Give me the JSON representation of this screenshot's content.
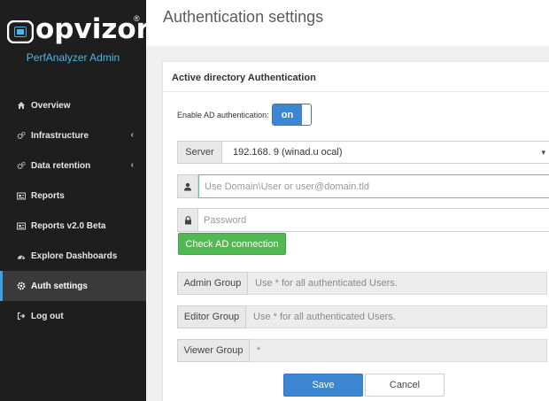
{
  "brand": {
    "logo_text": "opvizor",
    "logo_mark": "®",
    "subtitle": "PerfAnalyzer Admin",
    "accent": "#48b7f0"
  },
  "sidebar": {
    "items": [
      {
        "label": "Overview",
        "icon": "home-icon",
        "chevron": ""
      },
      {
        "label": "Infrastructure",
        "icon": "gears-icon",
        "chevron": "‹"
      },
      {
        "label": "Data retention",
        "icon": "gears-icon",
        "chevron": "‹"
      },
      {
        "label": "Reports",
        "icon": "report-icon",
        "chevron": ""
      },
      {
        "label": "Reports v2.0 Beta",
        "icon": "report-icon",
        "chevron": ""
      },
      {
        "label": "Explore Dashboards",
        "icon": "dashboard-icon",
        "chevron": ""
      },
      {
        "label": "Auth settings",
        "icon": "gear-icon",
        "chevron": "",
        "active": true
      },
      {
        "label": "Log out",
        "icon": "logout-icon",
        "chevron": ""
      }
    ]
  },
  "page": {
    "title": "Authentication settings"
  },
  "panel": {
    "title": "Active directory Authentication",
    "enable_label": "Enable AD authentication:",
    "toggle_state": "on",
    "server": {
      "label": "Server",
      "value": "192.168.            9 (winad.u                          ocal)",
      "caret": "▾"
    },
    "user": {
      "placeholder": "Use Domain\\User or user@domain.tld",
      "icon": "user-icon"
    },
    "password": {
      "placeholder": "Password",
      "icon": "lock-icon"
    },
    "check_button": "Check AD connection",
    "groups": [
      {
        "label": "Admin Group",
        "value": "Use * for all authenticated Users."
      },
      {
        "label": "Editor Group",
        "value": "Use * for all authenticated Users."
      },
      {
        "label": "Viewer Group",
        "value": "*"
      }
    ],
    "save_label": "Save",
    "cancel_label": "Cancel"
  },
  "colors": {
    "sidebar_bg": "#1e1e1e",
    "primary": "#3c86d2",
    "success": "#52b852",
    "focus_border": "#54c4b0"
  }
}
